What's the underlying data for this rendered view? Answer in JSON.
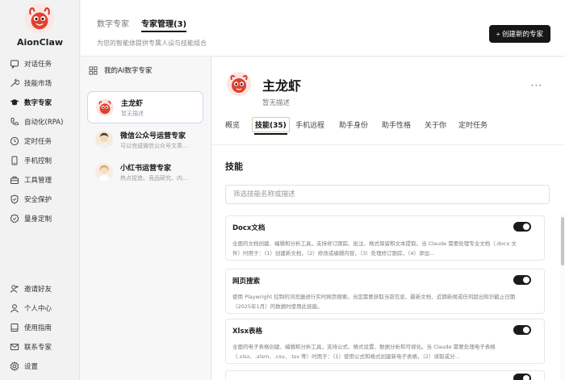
{
  "app": {
    "brand": "AionClaw"
  },
  "sidebar": {
    "top_items": [
      {
        "label": "对话任务",
        "icon": "chat-icon"
      },
      {
        "label": "技能市场",
        "icon": "wrench-icon"
      },
      {
        "label": "数字专家",
        "icon": "graduation-cap-icon",
        "active": true
      },
      {
        "label": "自动化(RPA)",
        "icon": "phone-icon"
      },
      {
        "label": "定时任务",
        "icon": "clock-icon"
      },
      {
        "label": "手机控制",
        "icon": "mobile-icon"
      },
      {
        "label": "工具管理",
        "icon": "toolbox-icon"
      },
      {
        "label": "安全保护",
        "icon": "shield-icon"
      },
      {
        "label": "量身定制",
        "icon": "badge-icon"
      }
    ],
    "bottom_items": [
      {
        "label": "邀请好友",
        "icon": "invite-icon"
      },
      {
        "label": "个人中心",
        "icon": "user-icon"
      },
      {
        "label": "使用指南",
        "icon": "book-icon"
      },
      {
        "label": "联系专家",
        "icon": "mail-icon"
      },
      {
        "label": "设置",
        "icon": "gear-icon"
      }
    ]
  },
  "header": {
    "tabs": [
      {
        "label": "数字专家",
        "active": false
      },
      {
        "label": "专家管理(3)",
        "active": true
      }
    ],
    "subtitle": "为您的智能体提供专属人设与技能组合",
    "create_button": "+ 创建新的专家"
  },
  "experts": {
    "heading": "我的AI数字专家",
    "items": [
      {
        "name": "主龙虾",
        "desc": "暂无描述",
        "selected": true
      },
      {
        "name": "微信公众号运营专家",
        "desc": "可以完成微信公众号文章..."
      },
      {
        "name": "小红书运营专家",
        "desc": "热点捏造、竞品研究、内..."
      }
    ]
  },
  "detail": {
    "name": "主龙虾",
    "desc": "暂无描述",
    "more": "···",
    "tabs": [
      {
        "label": "概览"
      },
      {
        "label": "技能(35)",
        "active": true
      },
      {
        "label": "手机远程"
      },
      {
        "label": "助手身份"
      },
      {
        "label": "助手性格"
      },
      {
        "label": "关于你"
      },
      {
        "label": "定时任务"
      }
    ],
    "skills_title": "技能",
    "filter_placeholder": "筛选技能名称或描述",
    "skills": [
      {
        "name": "Docx文档",
        "desc": "全面的文档创建、编辑和分析工具，支持修订跟踪、批注、格式保留和文本提取。当 Claude 需要处理专业文档（.docx 文件）时用于：（1）创建新文档，（2）修改或编辑内容，（3）处理修订跟踪，（4）添加...",
        "enabled": true
      },
      {
        "name": "网页搜索",
        "desc": "使用 Playwright 控制的浏览器进行实时网页搜索。当您需要获取当前信息、最新文档、近期新闻或任何超出知识截止日期（2025年1月）的数据时使用此技能。",
        "enabled": true
      },
      {
        "name": "Xlsx表格",
        "desc": "全面的电子表格创建、编辑和分析工具，支持公式、格式设置、数据分析和可视化。当 Claude 需要处理电子表格（.xlsx、.xlsm、.csv、.tsv 等）时用于：（1）使用公式和格式创建新电子表格，（2）读取或分...",
        "enabled": true
      },
      {
        "name": "",
        "desc": "",
        "enabled": true
      }
    ]
  },
  "colors": {
    "accent": "#161616",
    "selected_border": "#c9d7f3",
    "brand_red": "#e2412f"
  }
}
